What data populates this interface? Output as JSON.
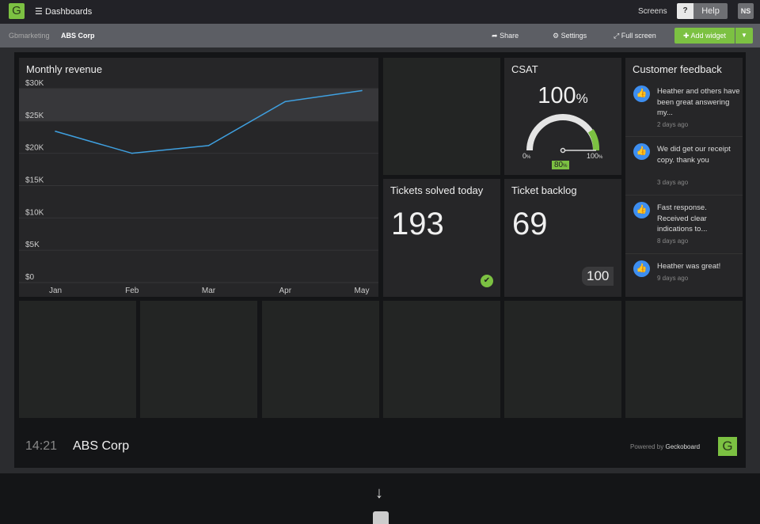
{
  "topbar": {
    "logo": "G",
    "dashboards": "Dashboards",
    "screens": "Screens",
    "help_q": "?",
    "help": "Help",
    "user": "NS"
  },
  "subbar": {
    "breadcrumb": [
      "Gbmarketing",
      "ABS Corp"
    ],
    "share": "Share",
    "settings": "Settings",
    "fullscreen": "Full screen",
    "add_widget": "Add widget"
  },
  "widgets": {
    "revenue": {
      "title": "Monthly revenue"
    },
    "csat": {
      "title": "CSAT",
      "value": "100",
      "unit": "%",
      "min": "0",
      "max": "100",
      "target": "80",
      "pct": "%",
      "gauge_fraction": 1.0,
      "target_fraction": 0.8
    },
    "tickets": {
      "title": "Tickets solved today",
      "value": "193"
    },
    "backlog": {
      "title": "Ticket backlog",
      "value": "69",
      "comparison": "100"
    },
    "feedback": {
      "title": "Customer feedback",
      "items": [
        {
          "text": "Heather and others have been great answering my...",
          "time": "2 days ago"
        },
        {
          "text": "We did get our receipt copy. thank you",
          "time": "3 days ago"
        },
        {
          "text": "Fast response. Received clear indications to...",
          "time": "8 days ago"
        },
        {
          "text": "Heather was great!",
          "time": "9 days ago"
        }
      ]
    }
  },
  "footer": {
    "time": "14:21",
    "name": "ABS Corp",
    "powered": "Powered by",
    "brand": "Geckoboard",
    "logo": "G"
  },
  "colors": {
    "accent": "#7cc142",
    "line": "#3fa0e0",
    "thumb": "#3d8ef0"
  },
  "chart_data": {
    "type": "line",
    "title": "Monthly revenue",
    "categories": [
      "Jan",
      "Feb",
      "Mar",
      "Apr",
      "May"
    ],
    "series": [
      {
        "name": "Revenue",
        "values": [
          23400,
          20000,
          21200,
          28000,
          29700
        ]
      }
    ],
    "ylim": [
      0,
      30000
    ],
    "yticks": [
      "$0",
      "$5K",
      "$10K",
      "$15K",
      "$20K",
      "$25K",
      "$30K"
    ],
    "target_band": [
      25000,
      30000
    ],
    "grid": true
  }
}
